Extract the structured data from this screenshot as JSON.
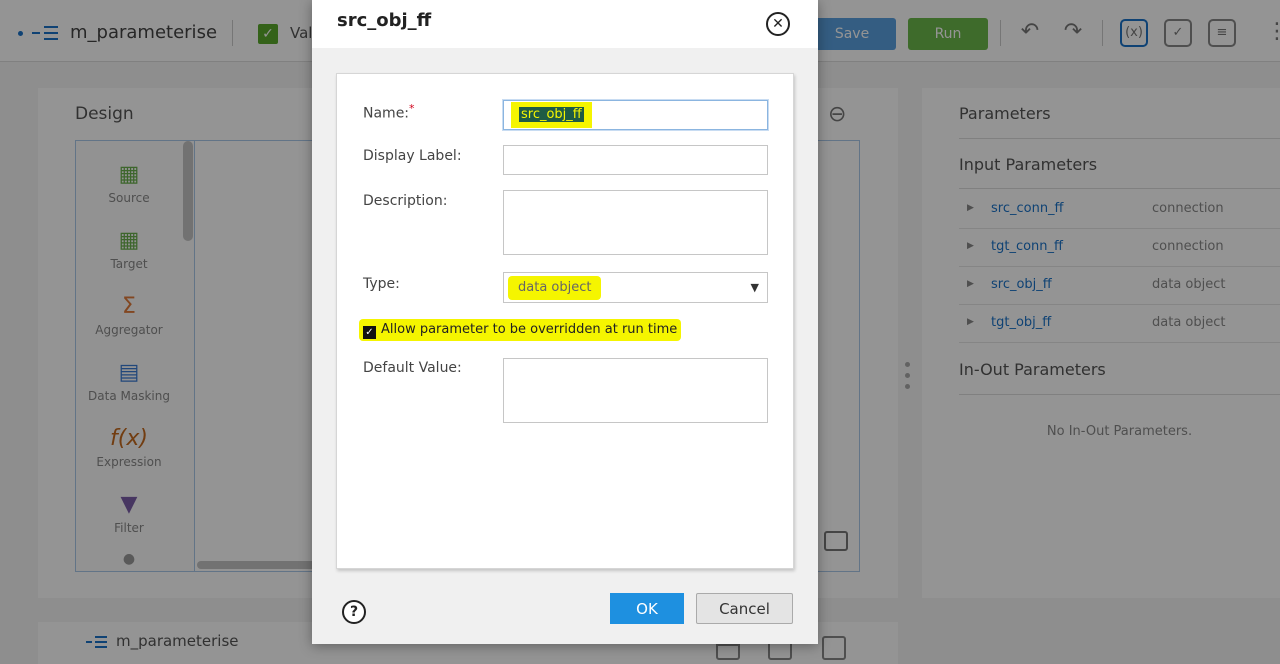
{
  "toolbar": {
    "mapping_name": "m_parameterise",
    "validation_label": "Val",
    "save_label": "Save",
    "run_label": "Run",
    "colors": {
      "save": "#5aa0e0",
      "run": "#6cb84a"
    }
  },
  "design": {
    "title": "Design",
    "palette": [
      {
        "label": "Source",
        "icon": "source-icon"
      },
      {
        "label": "Target",
        "icon": "target-icon"
      },
      {
        "label": "Aggregator",
        "icon": "aggregator-icon"
      },
      {
        "label": "Data Masking",
        "icon": "data-masking-icon"
      },
      {
        "label": "Expression",
        "icon": "expression-icon"
      },
      {
        "label": "Filter",
        "icon": "filter-icon"
      }
    ]
  },
  "parameters": {
    "title": "Parameters",
    "input_title": "Input Parameters",
    "input": [
      {
        "name": "src_conn_ff",
        "type": "connection"
      },
      {
        "name": "tgt_conn_ff",
        "type": "connection"
      },
      {
        "name": "src_obj_ff",
        "type": "data object"
      },
      {
        "name": "tgt_obj_ff",
        "type": "data object"
      }
    ],
    "inout_title": "In-Out Parameters",
    "inout_empty": "No In-Out Parameters."
  },
  "bottom_panel": {
    "title": "m_parameterise"
  },
  "dialog": {
    "title": "src_obj_ff",
    "name_label": "Name:",
    "required_marker": "*",
    "name_value": "src_obj_ff",
    "display_label_label": "Display Label:",
    "display_label_value": "",
    "description_label": "Description:",
    "description_value": "",
    "type_label": "Type:",
    "type_value": "data object",
    "override_label": "Allow parameter to be overridden at run time",
    "override_checked": true,
    "default_value_label": "Default Value:",
    "default_value": "",
    "ok_label": "OK",
    "cancel_label": "Cancel",
    "highlight_color": "#f5f500",
    "ok_color": "#1e90e0"
  }
}
